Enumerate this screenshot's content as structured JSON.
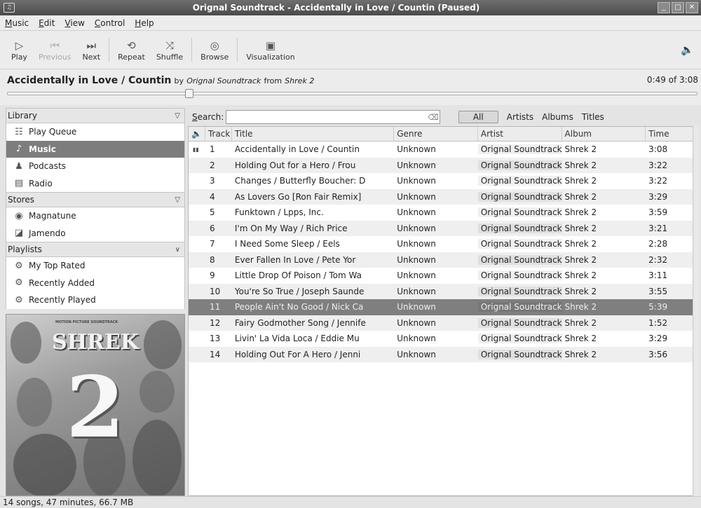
{
  "window": {
    "title": "Orignal Soundtrack - Accidentally in Love / Countin (Paused)",
    "controls": [
      "minimize-icon",
      "maximize-icon",
      "close-icon"
    ]
  },
  "menu": [
    "Music",
    "Edit",
    "View",
    "Control",
    "Help"
  ],
  "toolbar": {
    "play": "Play",
    "previous": "Previous",
    "next": "Next",
    "repeat": "Repeat",
    "shuffle": "Shuffle",
    "browse": "Browse",
    "visualization": "Visualization"
  },
  "now_playing": {
    "title": "Accidentally in Love / Countin",
    "by": "by",
    "artist": "Orignal Soundtrack",
    "from": "from",
    "album": "Shrek 2",
    "time": "0:49 of 3:08",
    "progress_fraction": 0.26
  },
  "sidebar": {
    "library_label": "Library",
    "library": [
      {
        "label": "Play Queue",
        "icon": "queue-icon"
      },
      {
        "label": "Music",
        "icon": "music-note-icon",
        "selected": true
      },
      {
        "label": "Podcasts",
        "icon": "podcast-icon"
      },
      {
        "label": "Radio",
        "icon": "radio-icon"
      }
    ],
    "stores_label": "Stores",
    "stores": [
      {
        "label": "Magnatune",
        "icon": "magnatune-icon"
      },
      {
        "label": "Jamendo",
        "icon": "jamendo-icon"
      }
    ],
    "playlists_label": "Playlists",
    "playlists": [
      {
        "label": "My Top Rated",
        "icon": "smart-playlist-icon"
      },
      {
        "label": "Recently Added",
        "icon": "smart-playlist-icon"
      },
      {
        "label": "Recently Played",
        "icon": "smart-playlist-icon"
      }
    ]
  },
  "cover": {
    "small": "MOTION PICTURE SOUNDTRACK",
    "title": "SHREK",
    "number": "2"
  },
  "search": {
    "label": "Search:",
    "value": "",
    "filters": [
      "All",
      "Artists",
      "Albums",
      "Titles"
    ]
  },
  "tracks": {
    "columns": [
      "Track",
      "Title",
      "Genre",
      "Artist",
      "Album",
      "Time"
    ],
    "rows": [
      {
        "n": "1",
        "title": "Accidentally in Love / Countin",
        "genre": "Unknown",
        "artist": "Orignal Soundtrack",
        "album": "Shrek 2",
        "time": "3:08",
        "playing": true
      },
      {
        "n": "2",
        "title": "Holding Out for a Hero / Frou",
        "genre": "Unknown",
        "artist": "Orignal Soundtrack",
        "album": "Shrek 2",
        "time": "3:22"
      },
      {
        "n": "3",
        "title": "Changes / Butterfly Boucher: D",
        "genre": "Unknown",
        "artist": "Orignal Soundtrack",
        "album": "Shrek 2",
        "time": "3:22"
      },
      {
        "n": "4",
        "title": "As Lovers Go [Ron Fair Remix]",
        "genre": "Unknown",
        "artist": "Orignal Soundtrack",
        "album": "Shrek 2",
        "time": "3:29"
      },
      {
        "n": "5",
        "title": "Funktown / Lpps, Inc.",
        "genre": "Unknown",
        "artist": "Orignal Soundtrack",
        "album": "Shrek 2",
        "time": "3:59"
      },
      {
        "n": "6",
        "title": "I'm On My Way / Rich Price",
        "genre": "Unknown",
        "artist": "Orignal Soundtrack",
        "album": "Shrek 2",
        "time": "3:21"
      },
      {
        "n": "7",
        "title": "I Need Some Sleep / Eels",
        "genre": "Unknown",
        "artist": "Orignal Soundtrack",
        "album": "Shrek 2",
        "time": "2:28"
      },
      {
        "n": "8",
        "title": "Ever Fallen In Love / Pete Yor",
        "genre": "Unknown",
        "artist": "Orignal Soundtrack",
        "album": "Shrek 2",
        "time": "2:32"
      },
      {
        "n": "9",
        "title": "Little Drop Of Poison / Tom Wa",
        "genre": "Unknown",
        "artist": "Orignal Soundtrack",
        "album": "Shrek 2",
        "time": "3:11"
      },
      {
        "n": "10",
        "title": "You're So True / Joseph Saunde",
        "genre": "Unknown",
        "artist": "Orignal Soundtrack",
        "album": "Shrek 2",
        "time": "3:55"
      },
      {
        "n": "11",
        "title": "People Ain't No Good / Nick Ca",
        "genre": "Unknown",
        "artist": "Orignal Soundtrack",
        "album": "Shrek 2",
        "time": "5:39",
        "selected": true
      },
      {
        "n": "12",
        "title": "Fairy Godmother Song / Jennife",
        "genre": "Unknown",
        "artist": "Orignal Soundtrack",
        "album": "Shrek 2",
        "time": "1:52"
      },
      {
        "n": "13",
        "title": "Livin' La Vida Loca / Eddie Mu",
        "genre": "Unknown",
        "artist": "Orignal Soundtrack",
        "album": "Shrek 2",
        "time": "3:29"
      },
      {
        "n": "14",
        "title": "Holding Out For A Hero / Jenni",
        "genre": "Unknown",
        "artist": "Orignal Soundtrack",
        "album": "Shrek 2",
        "time": "3:56"
      }
    ]
  },
  "status": "14 songs, 47 minutes, 66.7 MB"
}
